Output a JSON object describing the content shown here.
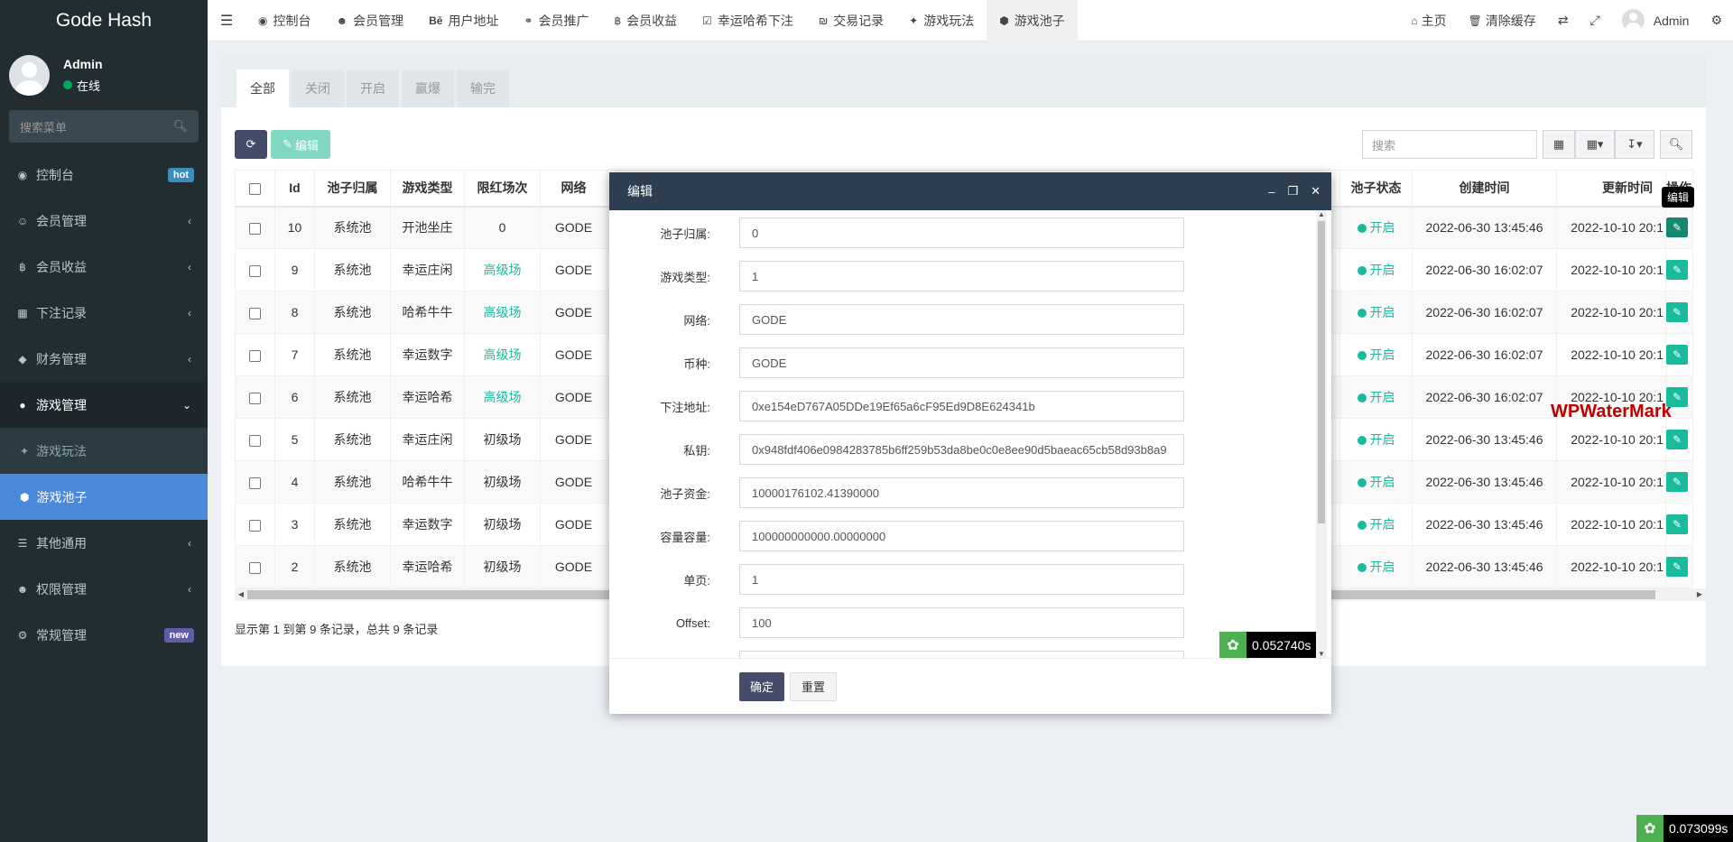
{
  "app": {
    "brand": "Gode Hash"
  },
  "user": {
    "name": "Admin",
    "status": "在线"
  },
  "sidebar": {
    "search_placeholder": "搜索菜单",
    "items": [
      {
        "label": "控制台",
        "icon": "dashboard-icon",
        "badge": "hot"
      },
      {
        "label": "会员管理",
        "icon": "user-circle-icon"
      },
      {
        "label": "会员收益",
        "icon": "bitcoin-icon"
      },
      {
        "label": "下注记录",
        "icon": "calendar-icon"
      },
      {
        "label": "财务管理",
        "icon": "diamond-icon"
      },
      {
        "label": "游戏管理",
        "icon": "gamepad-icon"
      },
      {
        "label": "其他通用",
        "icon": "list-icon"
      },
      {
        "label": "权限管理",
        "icon": "users-icon"
      },
      {
        "label": "常规管理",
        "icon": "cogs-icon",
        "badge": "new"
      }
    ],
    "submenu": [
      {
        "label": "游戏玩法",
        "icon": "compass-icon"
      },
      {
        "label": "游戏池子",
        "icon": "cube-icon"
      }
    ]
  },
  "topnav": {
    "tabs": [
      {
        "label": "控制台",
        "icon": "dashboard-icon"
      },
      {
        "label": "会员管理",
        "icon": "user-icon"
      },
      {
        "label": "用户地址",
        "icon": "behance-icon",
        "prefix": "Bē"
      },
      {
        "label": "会员推广",
        "icon": "handshake-icon"
      },
      {
        "label": "会员收益",
        "icon": "bitcoin-icon"
      },
      {
        "label": "幸运哈希下注",
        "icon": "calendar-check-icon"
      },
      {
        "label": "交易记录",
        "icon": "ils-icon"
      },
      {
        "label": "游戏玩法",
        "icon": "compass-icon"
      },
      {
        "label": "游戏池子",
        "icon": "cube-icon"
      }
    ],
    "right": {
      "home": "主页",
      "clear_cache": "清除缓存",
      "user": "Admin"
    }
  },
  "panel": {
    "tabs": [
      "全部",
      "关闭",
      "开启",
      "赢爆",
      "输完"
    ],
    "edit_button": "编辑",
    "search_placeholder": "搜索",
    "columns": [
      "Id",
      "池子归属",
      "游戏类型",
      "限红场次",
      "网络",
      "池子状态",
      "创建时间",
      "更新时间",
      "操作"
    ],
    "rows": [
      {
        "id": "10",
        "owner": "系统池",
        "game": "开池坐庄",
        "limit": "0",
        "limit_green": false,
        "net": "GODE",
        "status": "开启",
        "created": "2022-06-30 13:45:46",
        "updated": "2022-10-10 20:1"
      },
      {
        "id": "9",
        "owner": "系统池",
        "game": "幸运庄闲",
        "limit": "高级场",
        "limit_green": true,
        "net": "GODE",
        "status": "开启",
        "created": "2022-06-30 16:02:07",
        "updated": "2022-10-10 20:1"
      },
      {
        "id": "8",
        "owner": "系统池",
        "game": "哈希牛牛",
        "limit": "高级场",
        "limit_green": true,
        "net": "GODE",
        "status": "开启",
        "created": "2022-06-30 16:02:07",
        "updated": "2022-10-10 20:1"
      },
      {
        "id": "7",
        "owner": "系统池",
        "game": "幸运数字",
        "limit": "高级场",
        "limit_green": true,
        "net": "GODE",
        "status": "开启",
        "created": "2022-06-30 16:02:07",
        "updated": "2022-10-10 20:1"
      },
      {
        "id": "6",
        "owner": "系统池",
        "game": "幸运哈希",
        "limit": "高级场",
        "limit_green": true,
        "net": "GODE",
        "status": "开启",
        "created": "2022-06-30 16:02:07",
        "updated": "2022-10-10 20:1"
      },
      {
        "id": "5",
        "owner": "系统池",
        "game": "幸运庄闲",
        "limit": "初级场",
        "limit_green": false,
        "net": "GODE",
        "status": "开启",
        "created": "2022-06-30 13:45:46",
        "updated": "2022-10-10 20:1"
      },
      {
        "id": "4",
        "owner": "系统池",
        "game": "哈希牛牛",
        "limit": "初级场",
        "limit_green": false,
        "net": "GODE",
        "status": "开启",
        "created": "2022-06-30 13:45:46",
        "updated": "2022-10-10 20:1"
      },
      {
        "id": "3",
        "owner": "系统池",
        "game": "幸运数字",
        "limit": "初级场",
        "limit_green": false,
        "net": "GODE",
        "status": "开启",
        "created": "2022-06-30 13:45:46",
        "updated": "2022-10-10 20:1"
      },
      {
        "id": "2",
        "owner": "系统池",
        "game": "幸运哈希",
        "limit": "初级场",
        "limit_green": false,
        "net": "GODE",
        "status": "开启",
        "created": "2022-06-30 13:45:46",
        "updated": "2022-10-10 20:1"
      }
    ],
    "page_info": "显示第 1 到第 9 条记录，总共 9 条记录",
    "tooltip": "编辑"
  },
  "modal": {
    "title": "编辑",
    "fields": [
      {
        "label": "池子归属:",
        "value": "0"
      },
      {
        "label": "游戏类型:",
        "value": "1"
      },
      {
        "label": "网络:",
        "value": "GODE"
      },
      {
        "label": "币种:",
        "value": "GODE"
      },
      {
        "label": "下注地址:",
        "value": "0xe154eD767A05DDe19Ef65a6cF95Ed9D8E624341b"
      },
      {
        "label": "私钥:",
        "value": "0x948fdf406e0984283785b6ff259b53da8be0c0e8ee90d5baeac65cb58d93b8a9"
      },
      {
        "label": "池子资金:",
        "value": "10000176102.41390000"
      },
      {
        "label": "容量容量:",
        "value": "100000000000.00000000"
      },
      {
        "label": "单页:",
        "value": "1"
      },
      {
        "label": "Offset:",
        "value": "100"
      }
    ],
    "confirm": "确定",
    "reset": "重置",
    "timer": "0.052740s"
  },
  "watermark": "WPWaterMark",
  "page_timer": "0.073099s",
  "colors": {
    "sidebar_bg": "#222d32",
    "accent": "#4a89dc",
    "success": "#18bc9c",
    "modal_header": "#2c3e50"
  }
}
